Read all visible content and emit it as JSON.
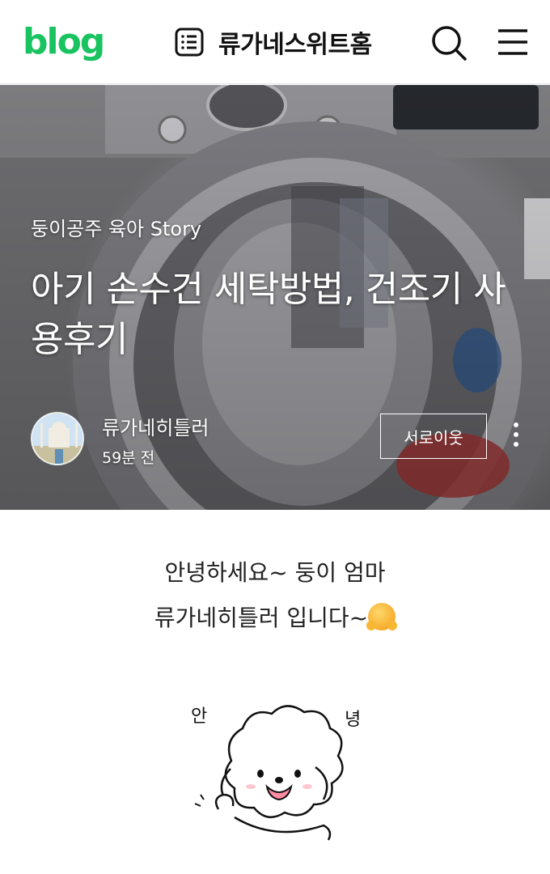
{
  "header": {
    "logo_text": "blog",
    "blog_title": "류가네스위트홈",
    "icons": [
      "list-icon",
      "search-icon",
      "menu-icon"
    ]
  },
  "post": {
    "category": "둥이공주 육아 Story",
    "title": "아기 손수건 세탁방법, 건조기 사용후기",
    "author": "류가네히틀러",
    "time": "59분 전",
    "neighbor_button": "서로이웃"
  },
  "content": {
    "greeting_line1": "안녕하세요~ 둥이 엄마",
    "greeting_line2": "류가네히틀러 입니다~",
    "sticker_text_left": "안",
    "sticker_text_right": "녕"
  },
  "colors": {
    "brand_green": "#19c35f",
    "white": "#ffffff",
    "text": "#111111"
  }
}
